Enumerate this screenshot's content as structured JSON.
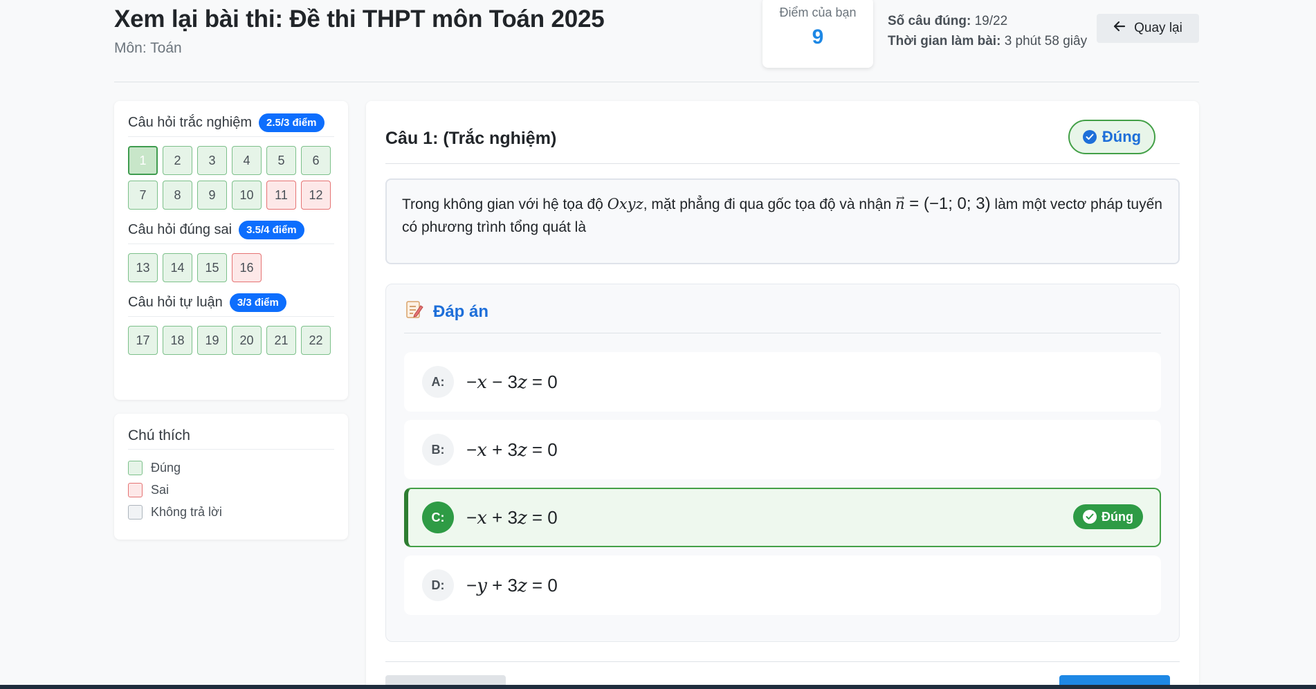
{
  "header": {
    "title": "Xem lại bài thi: Đề thi THPT môn Toán 2025",
    "subject": "Môn: Toán",
    "score_label": "Điểm của bạn",
    "score_value": "9",
    "correct_label": "Số câu đúng:",
    "correct_value": "19/22",
    "time_label": "Thời gian làm bài:",
    "time_value": "3 phút 58 giây",
    "back_label": "Quay lại",
    "back_icon": "arrow-left-icon"
  },
  "sidebar": {
    "sections": [
      {
        "title": "Câu hỏi trắc nghiệm",
        "badge": "2.5/3 điểm",
        "questions": [
          {
            "n": "1",
            "status": "active"
          },
          {
            "n": "2",
            "status": "correct"
          },
          {
            "n": "3",
            "status": "correct"
          },
          {
            "n": "4",
            "status": "correct"
          },
          {
            "n": "5",
            "status": "correct"
          },
          {
            "n": "6",
            "status": "correct"
          },
          {
            "n": "7",
            "status": "correct"
          },
          {
            "n": "8",
            "status": "correct"
          },
          {
            "n": "9",
            "status": "correct"
          },
          {
            "n": "10",
            "status": "correct"
          },
          {
            "n": "11",
            "status": "wrong"
          },
          {
            "n": "12",
            "status": "wrong"
          }
        ]
      },
      {
        "title": "Câu hỏi đúng sai",
        "badge": "3.5/4 điểm",
        "questions": [
          {
            "n": "13",
            "status": "correct"
          },
          {
            "n": "14",
            "status": "correct"
          },
          {
            "n": "15",
            "status": "correct"
          },
          {
            "n": "16",
            "status": "wrong"
          }
        ]
      },
      {
        "title": "Câu hỏi tự luận",
        "badge": "3/3 điểm",
        "questions": [
          {
            "n": "17",
            "status": "correct"
          },
          {
            "n": "18",
            "status": "correct"
          },
          {
            "n": "19",
            "status": "correct"
          },
          {
            "n": "20",
            "status": "correct"
          },
          {
            "n": "21",
            "status": "correct"
          },
          {
            "n": "22",
            "status": "correct"
          }
        ]
      }
    ],
    "legend": {
      "title": "Chú thích",
      "items": [
        {
          "label": "Đúng",
          "kind": "green"
        },
        {
          "label": "Sai",
          "kind": "red"
        },
        {
          "label": "Không trả lời",
          "kind": "gray"
        }
      ]
    }
  },
  "question": {
    "title": "Câu 1: (Trắc nghiệm)",
    "status": "Đúng",
    "text_before": "Trong không gian với hệ tọa độ ",
    "space_symbol": "Oxyz",
    "text_middle": ", mặt phẳng đi qua gốc tọa độ và nhận ",
    "vector_symbol": "n",
    "vector_value": " = (−1; 0; 3)",
    "text_after": " làm một vectơ pháp tuyến có phương trình tổng quát là"
  },
  "answers": {
    "heading": "Đáp án",
    "heading_icon": "memo-icon",
    "correct_tag": "Đúng",
    "options": [
      {
        "letter": "A:",
        "parts": [
          "−",
          "x",
          " − 3",
          "z",
          " = 0"
        ],
        "correct": false
      },
      {
        "letter": "B:",
        "parts": [
          "−",
          "x",
          " + 3",
          "z",
          " = 0"
        ],
        "correct": false
      },
      {
        "letter": "C:",
        "parts": [
          "−",
          "x",
          " + 3",
          "z",
          " = 0"
        ],
        "correct": true
      },
      {
        "letter": "D:",
        "parts": [
          "−",
          "y",
          " + 3",
          "z",
          " = 0"
        ],
        "correct": false
      }
    ]
  },
  "colors": {
    "accent": "#1e88e5",
    "success": "#2e9b45",
    "danger": "#e57373"
  }
}
